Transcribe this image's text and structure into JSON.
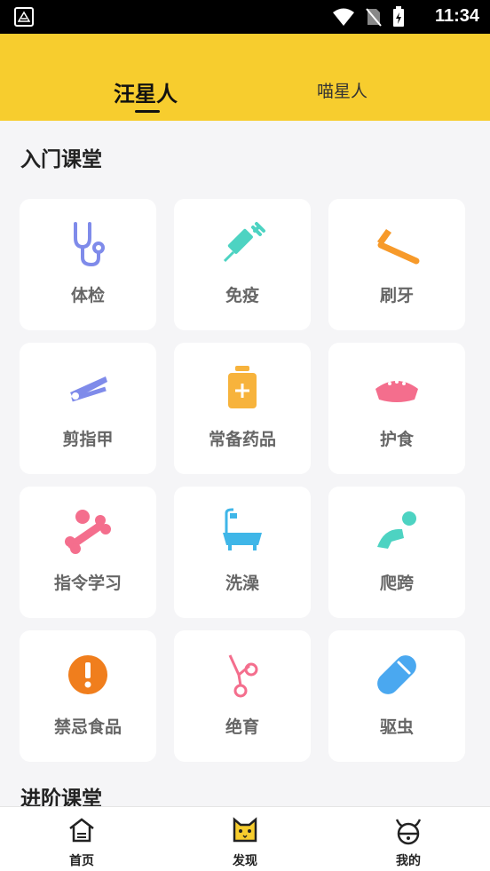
{
  "status_bar": {
    "time": "11:34"
  },
  "tabs": [
    {
      "label": "汪星人",
      "active": true
    },
    {
      "label": "喵星人",
      "active": false
    }
  ],
  "sections": {
    "intro": "入门课堂",
    "advanced": "进阶课堂"
  },
  "courses": [
    {
      "label": "体检",
      "icon": "stethoscope-icon",
      "color": "#7f8bea"
    },
    {
      "label": "免疫",
      "icon": "syringe-icon",
      "color": "#4dd3c2"
    },
    {
      "label": "刷牙",
      "icon": "toothbrush-icon",
      "color": "#f79a2a"
    },
    {
      "label": "剪指甲",
      "icon": "nail-clipper-icon",
      "color": "#7f8bea"
    },
    {
      "label": "常备药品",
      "icon": "medicine-box-icon",
      "color": "#f7b33c"
    },
    {
      "label": "护食",
      "icon": "food-bowl-icon",
      "color": "#f46e8d"
    },
    {
      "label": "指令学习",
      "icon": "bone-ball-icon",
      "color": "#f46e8d"
    },
    {
      "label": "洗澡",
      "icon": "bathtub-icon",
      "color": "#3fb6e8"
    },
    {
      "label": "爬跨",
      "icon": "crawling-icon",
      "color": "#4dd3c2"
    },
    {
      "label": "禁忌食品",
      "icon": "warning-icon",
      "color": "#f07e1d"
    },
    {
      "label": "绝育",
      "icon": "scissors-icon",
      "color": "#f46e8d"
    },
    {
      "label": "驱虫",
      "icon": "pill-capsule-icon",
      "color": "#4aa8f0"
    }
  ],
  "bottom_nav": [
    {
      "label": "首页",
      "icon": "home-icon"
    },
    {
      "label": "发现",
      "icon": "cat-face-icon"
    },
    {
      "label": "我的",
      "icon": "dog-face-icon"
    }
  ],
  "colors": {
    "header": "#f7cd2e",
    "background": "#f5f5f7"
  }
}
